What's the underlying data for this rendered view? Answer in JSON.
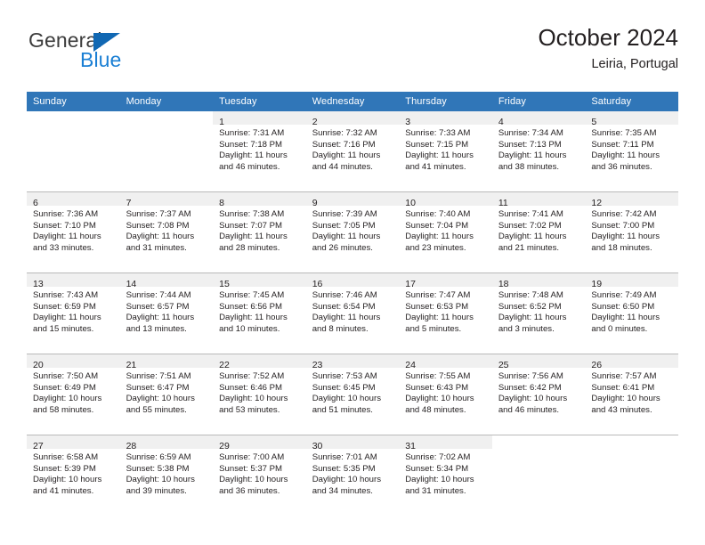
{
  "brand": {
    "name_top": "General",
    "name_bottom": "Blue",
    "triangle_color": "#1168b3",
    "blue_text_color": "#1a7fd4"
  },
  "header": {
    "title": "October 2024",
    "subtitle": "Leiria, Portugal"
  },
  "colors": {
    "header_blue": "#3076b8",
    "daynum_band": "#f0f0f0",
    "grid_line": "#b9b9b9",
    "text": "#231f20"
  },
  "weekdays": [
    "Sunday",
    "Monday",
    "Tuesday",
    "Wednesday",
    "Thursday",
    "Friday",
    "Saturday"
  ],
  "weeks": [
    [
      {
        "day": "",
        "lines": []
      },
      {
        "day": "",
        "lines": []
      },
      {
        "day": "1",
        "lines": [
          "Sunrise: 7:31 AM",
          "Sunset: 7:18 PM",
          "Daylight: 11 hours",
          "and 46 minutes."
        ]
      },
      {
        "day": "2",
        "lines": [
          "Sunrise: 7:32 AM",
          "Sunset: 7:16 PM",
          "Daylight: 11 hours",
          "and 44 minutes."
        ]
      },
      {
        "day": "3",
        "lines": [
          "Sunrise: 7:33 AM",
          "Sunset: 7:15 PM",
          "Daylight: 11 hours",
          "and 41 minutes."
        ]
      },
      {
        "day": "4",
        "lines": [
          "Sunrise: 7:34 AM",
          "Sunset: 7:13 PM",
          "Daylight: 11 hours",
          "and 38 minutes."
        ]
      },
      {
        "day": "5",
        "lines": [
          "Sunrise: 7:35 AM",
          "Sunset: 7:11 PM",
          "Daylight: 11 hours",
          "and 36 minutes."
        ]
      }
    ],
    [
      {
        "day": "6",
        "lines": [
          "Sunrise: 7:36 AM",
          "Sunset: 7:10 PM",
          "Daylight: 11 hours",
          "and 33 minutes."
        ]
      },
      {
        "day": "7",
        "lines": [
          "Sunrise: 7:37 AM",
          "Sunset: 7:08 PM",
          "Daylight: 11 hours",
          "and 31 minutes."
        ]
      },
      {
        "day": "8",
        "lines": [
          "Sunrise: 7:38 AM",
          "Sunset: 7:07 PM",
          "Daylight: 11 hours",
          "and 28 minutes."
        ]
      },
      {
        "day": "9",
        "lines": [
          "Sunrise: 7:39 AM",
          "Sunset: 7:05 PM",
          "Daylight: 11 hours",
          "and 26 minutes."
        ]
      },
      {
        "day": "10",
        "lines": [
          "Sunrise: 7:40 AM",
          "Sunset: 7:04 PM",
          "Daylight: 11 hours",
          "and 23 minutes."
        ]
      },
      {
        "day": "11",
        "lines": [
          "Sunrise: 7:41 AM",
          "Sunset: 7:02 PM",
          "Daylight: 11 hours",
          "and 21 minutes."
        ]
      },
      {
        "day": "12",
        "lines": [
          "Sunrise: 7:42 AM",
          "Sunset: 7:00 PM",
          "Daylight: 11 hours",
          "and 18 minutes."
        ]
      }
    ],
    [
      {
        "day": "13",
        "lines": [
          "Sunrise: 7:43 AM",
          "Sunset: 6:59 PM",
          "Daylight: 11 hours",
          "and 15 minutes."
        ]
      },
      {
        "day": "14",
        "lines": [
          "Sunrise: 7:44 AM",
          "Sunset: 6:57 PM",
          "Daylight: 11 hours",
          "and 13 minutes."
        ]
      },
      {
        "day": "15",
        "lines": [
          "Sunrise: 7:45 AM",
          "Sunset: 6:56 PM",
          "Daylight: 11 hours",
          "and 10 minutes."
        ]
      },
      {
        "day": "16",
        "lines": [
          "Sunrise: 7:46 AM",
          "Sunset: 6:54 PM",
          "Daylight: 11 hours",
          "and 8 minutes."
        ]
      },
      {
        "day": "17",
        "lines": [
          "Sunrise: 7:47 AM",
          "Sunset: 6:53 PM",
          "Daylight: 11 hours",
          "and 5 minutes."
        ]
      },
      {
        "day": "18",
        "lines": [
          "Sunrise: 7:48 AM",
          "Sunset: 6:52 PM",
          "Daylight: 11 hours",
          "and 3 minutes."
        ]
      },
      {
        "day": "19",
        "lines": [
          "Sunrise: 7:49 AM",
          "Sunset: 6:50 PM",
          "Daylight: 11 hours",
          "and 0 minutes."
        ]
      }
    ],
    [
      {
        "day": "20",
        "lines": [
          "Sunrise: 7:50 AM",
          "Sunset: 6:49 PM",
          "Daylight: 10 hours",
          "and 58 minutes."
        ]
      },
      {
        "day": "21",
        "lines": [
          "Sunrise: 7:51 AM",
          "Sunset: 6:47 PM",
          "Daylight: 10 hours",
          "and 55 minutes."
        ]
      },
      {
        "day": "22",
        "lines": [
          "Sunrise: 7:52 AM",
          "Sunset: 6:46 PM",
          "Daylight: 10 hours",
          "and 53 minutes."
        ]
      },
      {
        "day": "23",
        "lines": [
          "Sunrise: 7:53 AM",
          "Sunset: 6:45 PM",
          "Daylight: 10 hours",
          "and 51 minutes."
        ]
      },
      {
        "day": "24",
        "lines": [
          "Sunrise: 7:55 AM",
          "Sunset: 6:43 PM",
          "Daylight: 10 hours",
          "and 48 minutes."
        ]
      },
      {
        "day": "25",
        "lines": [
          "Sunrise: 7:56 AM",
          "Sunset: 6:42 PM",
          "Daylight: 10 hours",
          "and 46 minutes."
        ]
      },
      {
        "day": "26",
        "lines": [
          "Sunrise: 7:57 AM",
          "Sunset: 6:41 PM",
          "Daylight: 10 hours",
          "and 43 minutes."
        ]
      }
    ],
    [
      {
        "day": "27",
        "lines": [
          "Sunrise: 6:58 AM",
          "Sunset: 5:39 PM",
          "Daylight: 10 hours",
          "and 41 minutes."
        ]
      },
      {
        "day": "28",
        "lines": [
          "Sunrise: 6:59 AM",
          "Sunset: 5:38 PM",
          "Daylight: 10 hours",
          "and 39 minutes."
        ]
      },
      {
        "day": "29",
        "lines": [
          "Sunrise: 7:00 AM",
          "Sunset: 5:37 PM",
          "Daylight: 10 hours",
          "and 36 minutes."
        ]
      },
      {
        "day": "30",
        "lines": [
          "Sunrise: 7:01 AM",
          "Sunset: 5:35 PM",
          "Daylight: 10 hours",
          "and 34 minutes."
        ]
      },
      {
        "day": "31",
        "lines": [
          "Sunrise: 7:02 AM",
          "Sunset: 5:34 PM",
          "Daylight: 10 hours",
          "and 31 minutes."
        ]
      },
      {
        "day": "",
        "lines": []
      },
      {
        "day": "",
        "lines": []
      }
    ]
  ]
}
